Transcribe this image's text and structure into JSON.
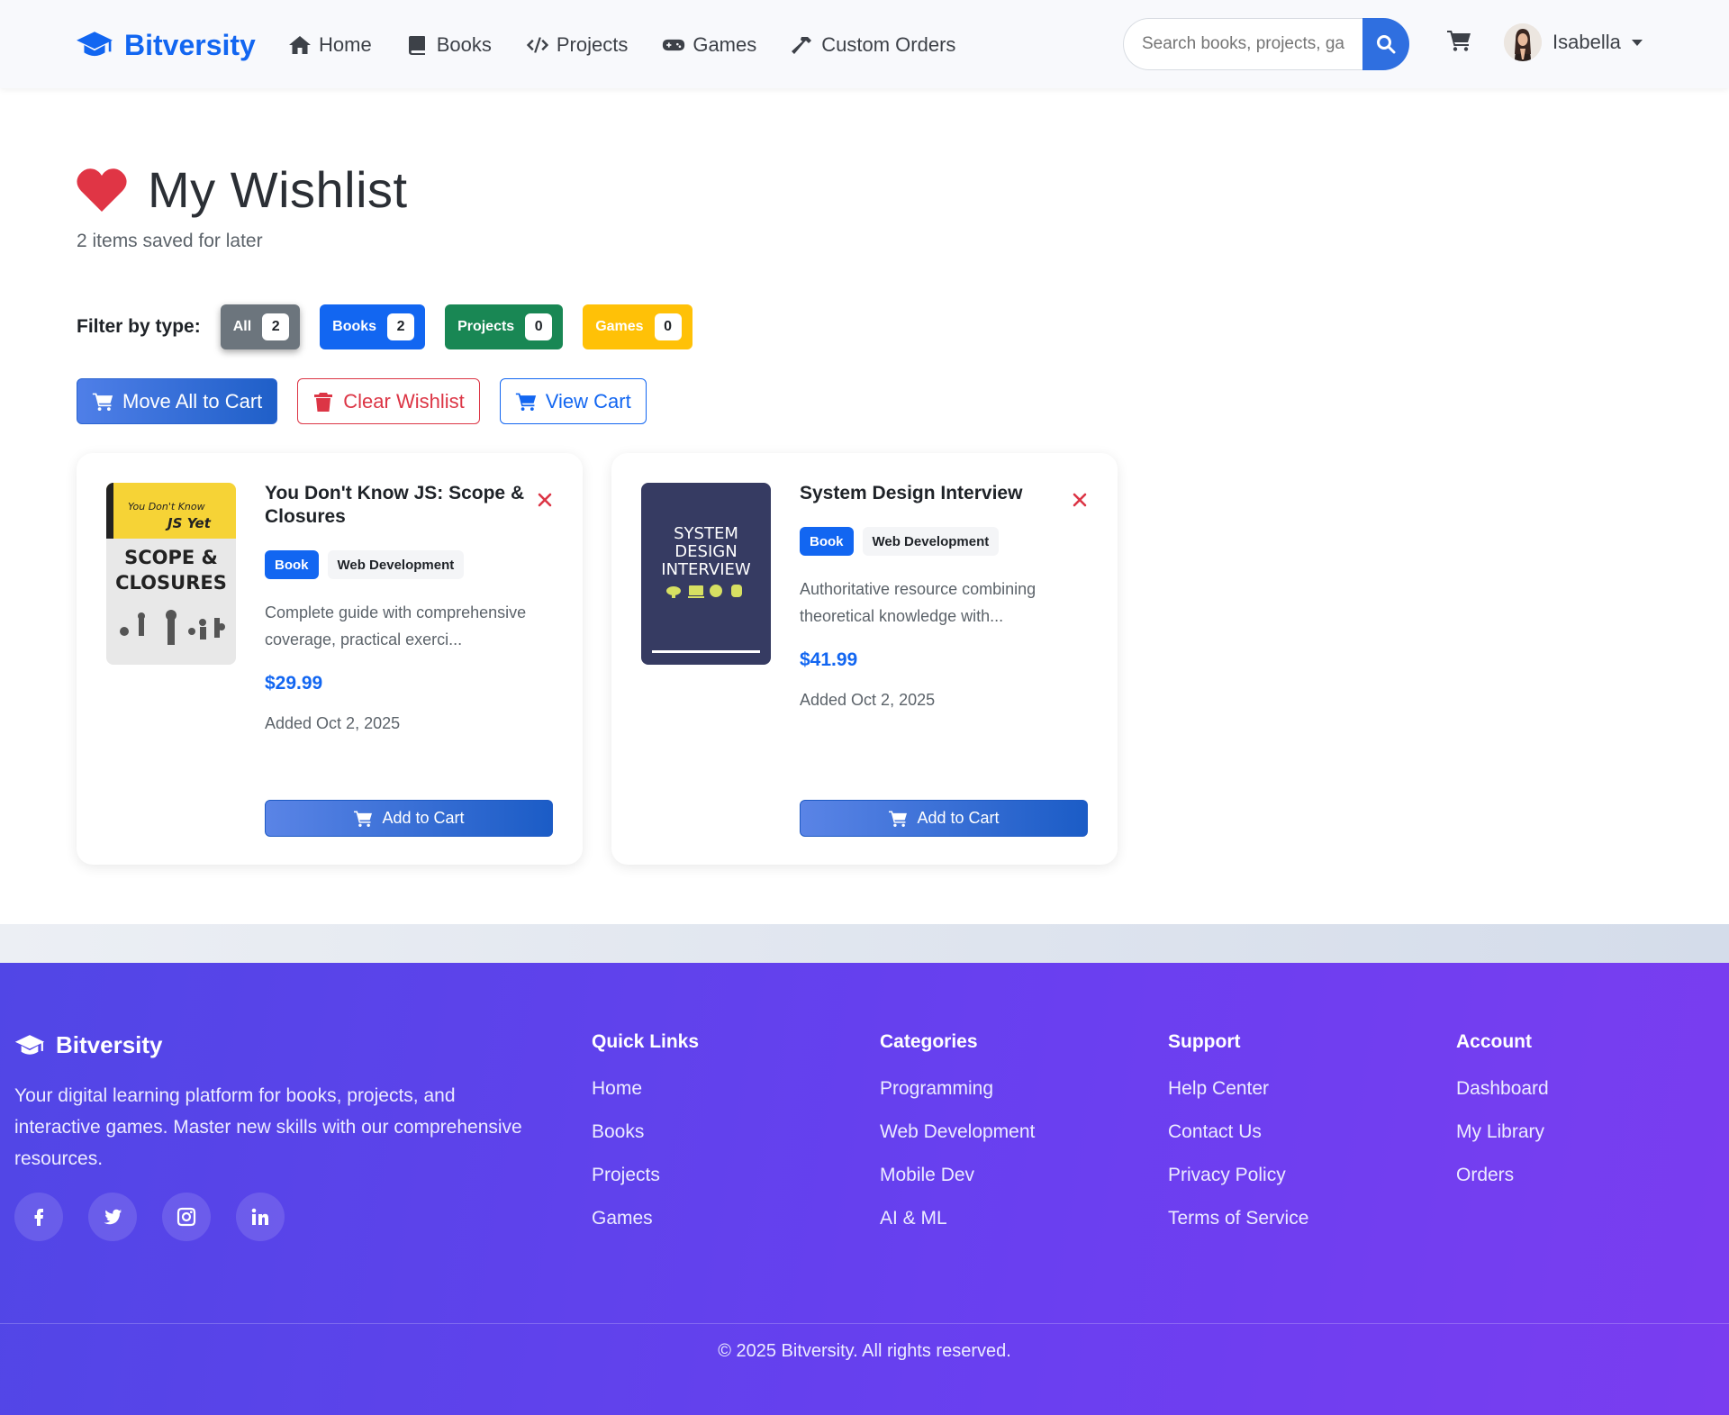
{
  "nav": {
    "brand": "Bitversity",
    "links": [
      {
        "label": "Home",
        "icon": "home-icon"
      },
      {
        "label": "Books",
        "icon": "book-icon"
      },
      {
        "label": "Projects",
        "icon": "code-icon"
      },
      {
        "label": "Games",
        "icon": "gamepad-icon"
      },
      {
        "label": "Custom Orders",
        "icon": "hammer-icon"
      }
    ],
    "search_placeholder": "Search books, projects, games...",
    "user_name": "Isabella"
  },
  "page": {
    "title": "My Wishlist",
    "subtitle": "2 items saved for later"
  },
  "filters": {
    "label": "Filter by type:",
    "items": [
      {
        "label": "All",
        "count": "2"
      },
      {
        "label": "Books",
        "count": "2"
      },
      {
        "label": "Projects",
        "count": "0"
      },
      {
        "label": "Games",
        "count": "0"
      }
    ]
  },
  "actions": {
    "move_all": "Move All to Cart",
    "clear": "Clear Wishlist",
    "view_cart": "View Cart"
  },
  "items": [
    {
      "title": "You Don't Know JS: Scope & Closures",
      "type": "Book",
      "category": "Web Development",
      "description": "Complete guide with comprehensive coverage, practical exerci...",
      "price": "$29.99",
      "added": "Added Oct 2, 2025",
      "cover_top": "You Don't Know",
      "cover_yet": "JS Yet",
      "cover_title_1": "SCOPE &",
      "cover_title_2": "CLOSURES",
      "add_label": "Add to Cart"
    },
    {
      "title": "System Design Interview",
      "type": "Book",
      "category": "Web Development",
      "description": "Authoritative resource combining theoretical knowledge with...",
      "price": "$41.99",
      "added": "Added Oct 2, 2025",
      "cover_line_1": "SYSTEM",
      "cover_line_2": "DESIGN",
      "cover_line_3": "INTERVIEW",
      "add_label": "Add to Cart"
    }
  ],
  "footer": {
    "brand": "Bitversity",
    "about": "Your digital learning platform for books, projects, and interactive games. Master new skills with our comprehensive resources.",
    "socials": [
      "facebook-icon",
      "twitter-icon",
      "instagram-icon",
      "linkedin-icon"
    ],
    "columns": [
      {
        "heading": "Quick Links",
        "links": [
          "Home",
          "Books",
          "Projects",
          "Games"
        ]
      },
      {
        "heading": "Categories",
        "links": [
          "Programming",
          "Web Development",
          "Mobile Dev",
          "AI & ML"
        ]
      },
      {
        "heading": "Support",
        "links": [
          "Help Center",
          "Contact Us",
          "Privacy Policy",
          "Terms of Service"
        ]
      },
      {
        "heading": "Account",
        "links": [
          "Dashboard",
          "My Library",
          "Orders"
        ]
      }
    ],
    "copyright": "© 2025 Bitversity. All rights reserved."
  },
  "colors": {
    "primary": "#1266f1",
    "danger": "#dc3545",
    "success": "#198754",
    "warning": "#ffc107",
    "secondary": "#6c757d",
    "footer": "#5b44ea"
  }
}
